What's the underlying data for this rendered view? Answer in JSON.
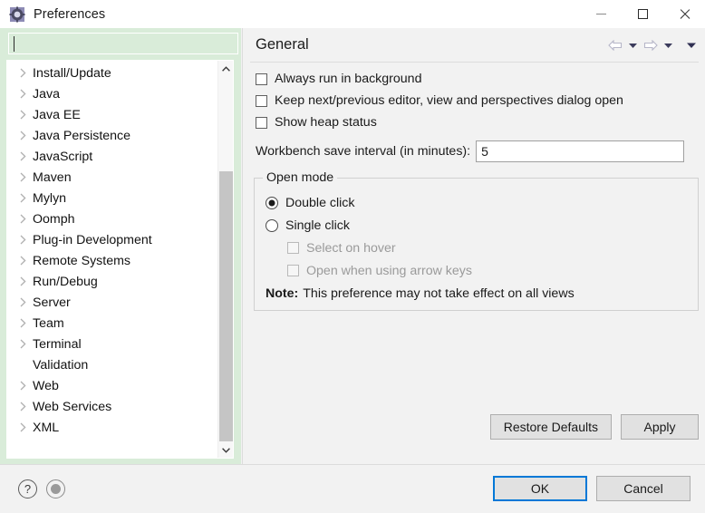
{
  "window": {
    "title": "Preferences",
    "icon": "preferences-gear-icon",
    "controls": {
      "minimize": "minimize-icon",
      "maximize": "maximize-icon",
      "close": "close-icon"
    }
  },
  "sidebar": {
    "filter": {
      "value": "",
      "placeholder": ""
    },
    "items": [
      {
        "label": "Install/Update",
        "expandable": true
      },
      {
        "label": "Java",
        "expandable": true
      },
      {
        "label": "Java EE",
        "expandable": true
      },
      {
        "label": "Java Persistence",
        "expandable": true
      },
      {
        "label": "JavaScript",
        "expandable": true
      },
      {
        "label": "Maven",
        "expandable": true
      },
      {
        "label": "Mylyn",
        "expandable": true
      },
      {
        "label": "Oomph",
        "expandable": true
      },
      {
        "label": "Plug-in Development",
        "expandable": true
      },
      {
        "label": "Remote Systems",
        "expandable": true
      },
      {
        "label": "Run/Debug",
        "expandable": true
      },
      {
        "label": "Server",
        "expandable": true
      },
      {
        "label": "Team",
        "expandable": true
      },
      {
        "label": "Terminal",
        "expandable": true
      },
      {
        "label": "Validation",
        "expandable": false
      },
      {
        "label": "Web",
        "expandable": true
      },
      {
        "label": "Web Services",
        "expandable": true
      },
      {
        "label": "XML",
        "expandable": true
      }
    ]
  },
  "page": {
    "title": "General",
    "nav": {
      "back": "back-arrow-icon",
      "back_menu": "back-dropdown-icon",
      "forward": "forward-arrow-icon",
      "forward_menu": "forward-dropdown-icon",
      "view_menu": "view-menu-icon"
    },
    "checkboxes": [
      {
        "label": "Always run in background",
        "checked": false,
        "enabled": true
      },
      {
        "label": "Keep next/previous editor, view and perspectives dialog open",
        "checked": false,
        "enabled": true
      },
      {
        "label": "Show heap status",
        "checked": false,
        "enabled": true
      }
    ],
    "save_interval": {
      "label": "Workbench save interval (in minutes):",
      "value": "5",
      "placeholder": ""
    },
    "open_mode": {
      "legend": "Open mode",
      "radios": [
        {
          "label": "Double click",
          "selected": true
        },
        {
          "label": "Single click",
          "selected": false
        }
      ],
      "sub_checkboxes": [
        {
          "label": "Select on hover",
          "checked": false,
          "enabled": false
        },
        {
          "label": "Open when using arrow keys",
          "checked": false,
          "enabled": false
        }
      ],
      "note_label": "Note:",
      "note_text": "This preference may not take effect on all views"
    },
    "actions": {
      "restore_defaults": "Restore Defaults",
      "apply": "Apply"
    }
  },
  "footer": {
    "help_icon": "help-icon",
    "help_glyph": "?",
    "record_icon": "record-circle-icon",
    "ok": "OK",
    "cancel": "Cancel"
  },
  "colors": {
    "filter_background": "#d9ecd9",
    "focus_border": "#0078d7",
    "dialog_background": "#f2f2f2",
    "tree_background": "#ffffff",
    "scrollbar_thumb": "#c5c5c5"
  }
}
